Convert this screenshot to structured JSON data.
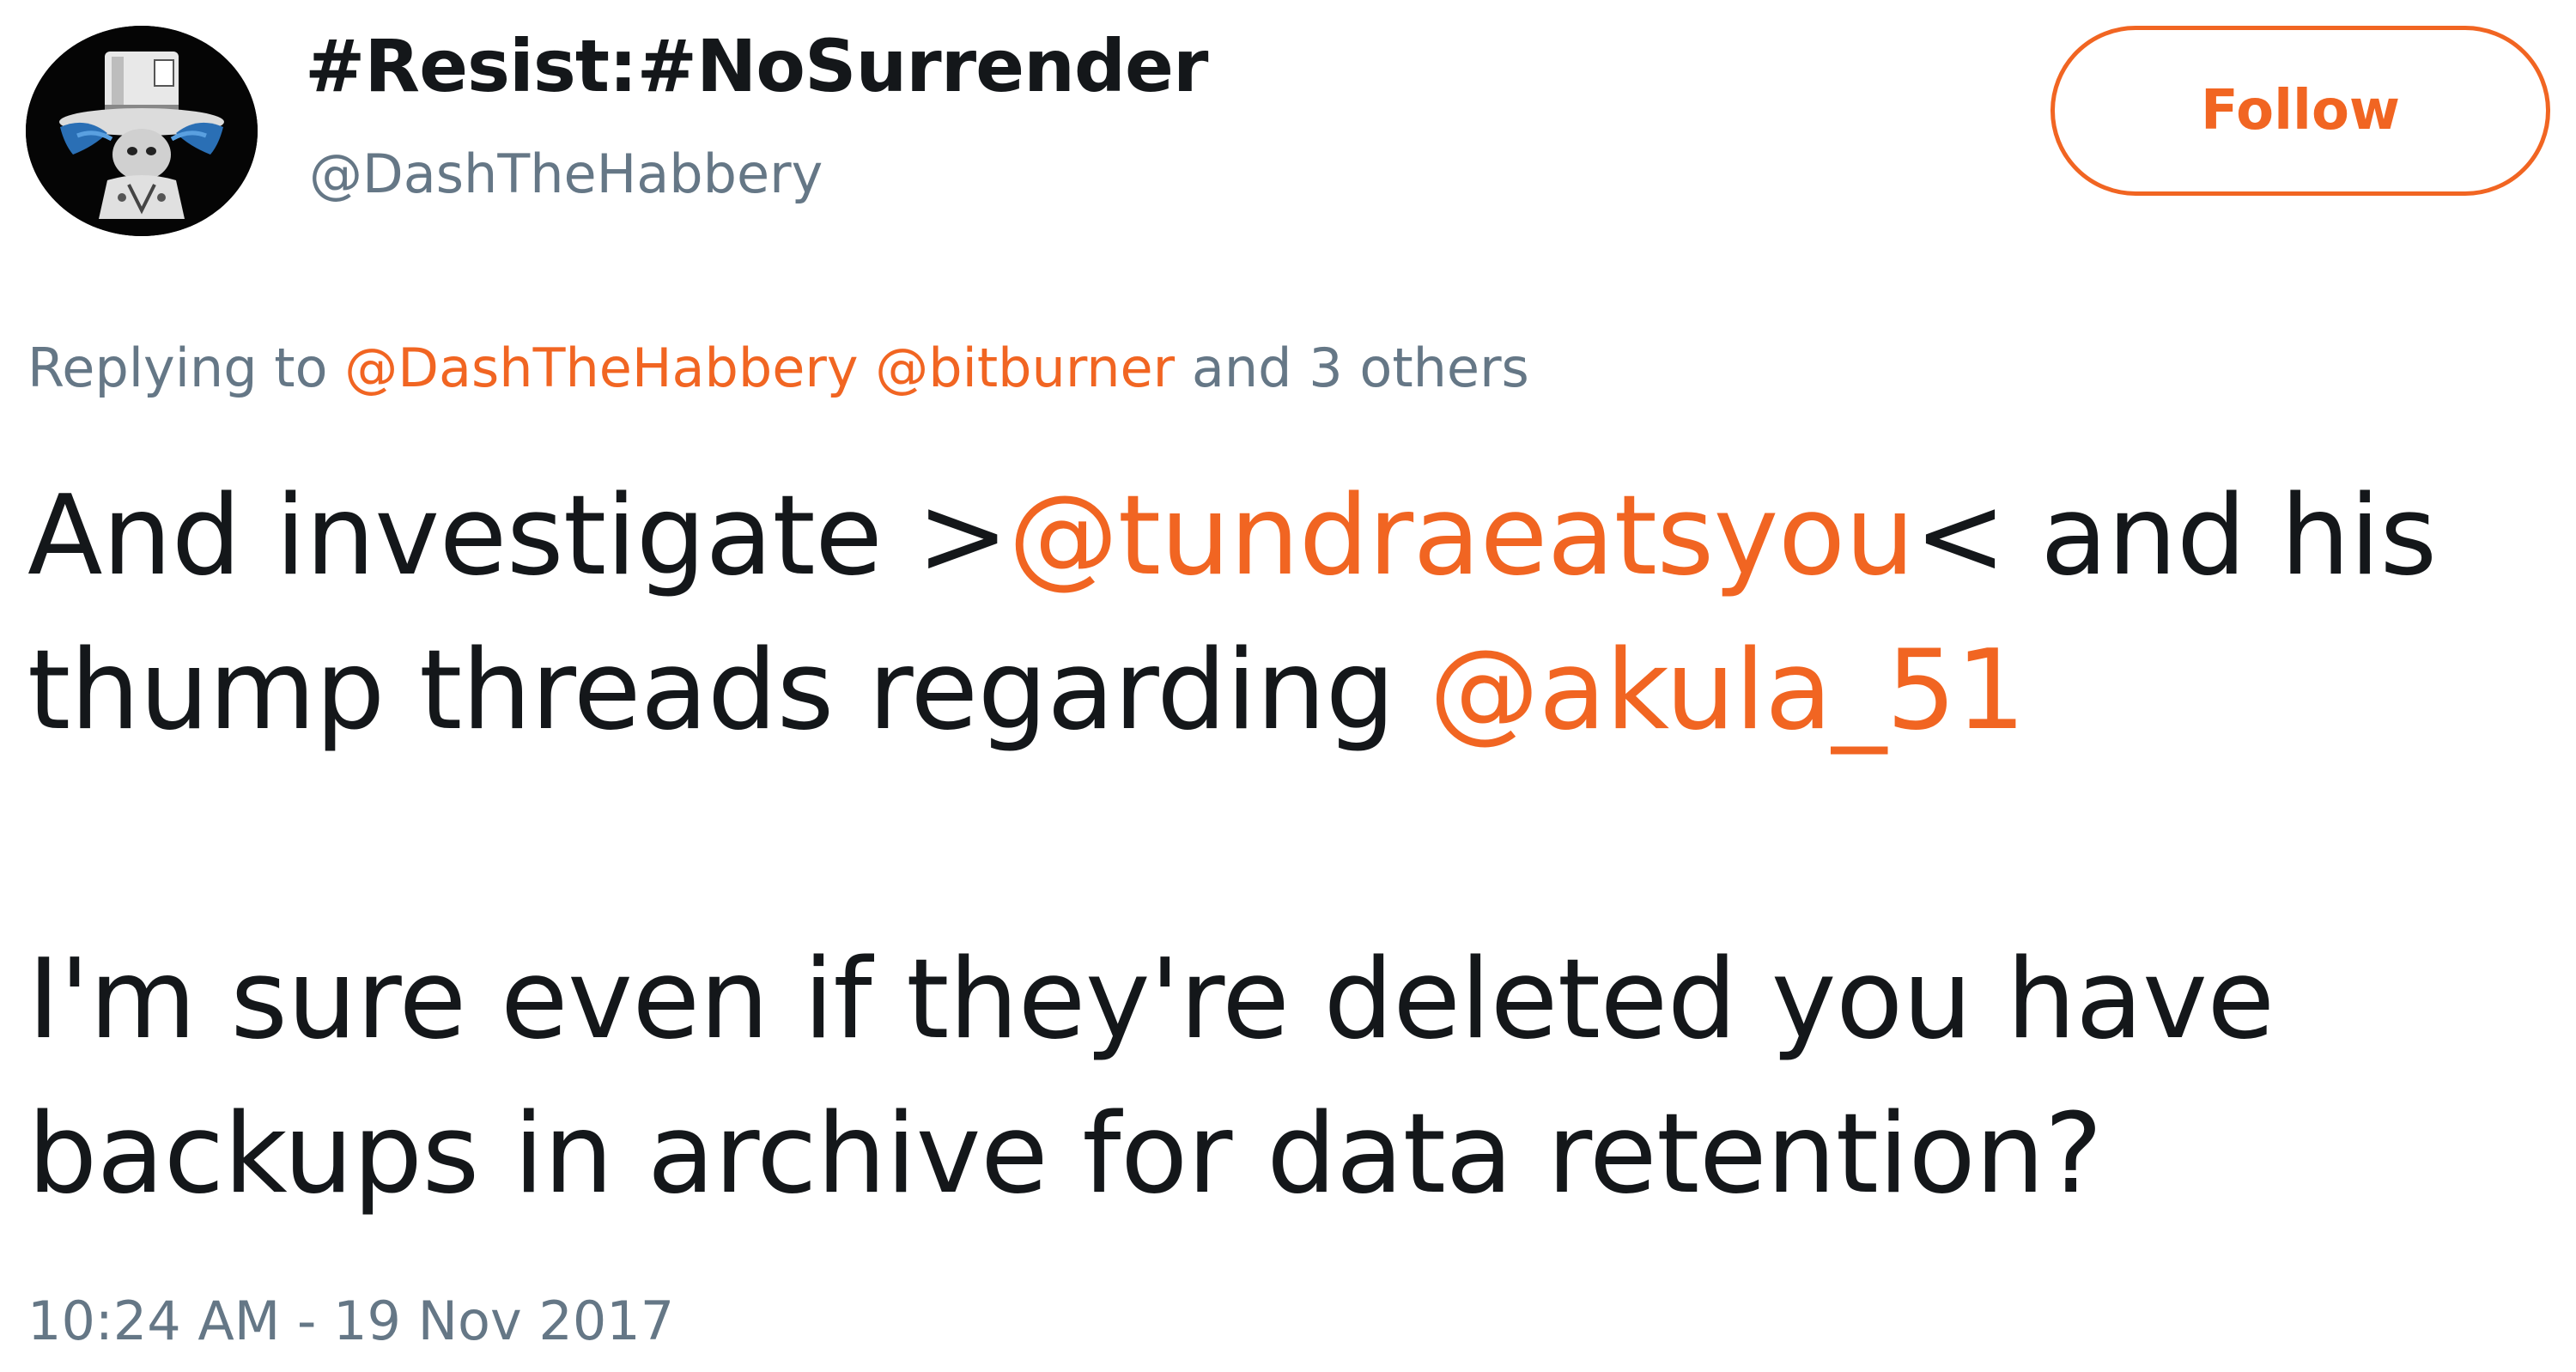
{
  "tweet": {
    "author": {
      "display_name": "#Resist:#NoSurrender",
      "handle": "@DashTheHabbery",
      "avatar_icon": "mad-hatter-avatar-icon"
    },
    "follow_label": "Follow",
    "reply": {
      "prefix": "Replying to",
      "mention_1": "@DashTheHabbery",
      "mention_2": "@bitburner",
      "suffix": "and 3 others"
    },
    "text": {
      "line1_a": "And investigate >",
      "line1_mention": "@tundraeatsyou",
      "line1_b": "< and his",
      "line2_a": "thump threads regarding ",
      "line2_mention": "@akula_51",
      "line3": "I'm sure even if they're deleted you have",
      "line4": "backups in archive for data retention?"
    },
    "timestamp": "10:24 AM - 19 Nov 2017"
  },
  "colors": {
    "accent": "#f16522",
    "secondary_text": "#657786",
    "primary_text": "#14171a"
  }
}
